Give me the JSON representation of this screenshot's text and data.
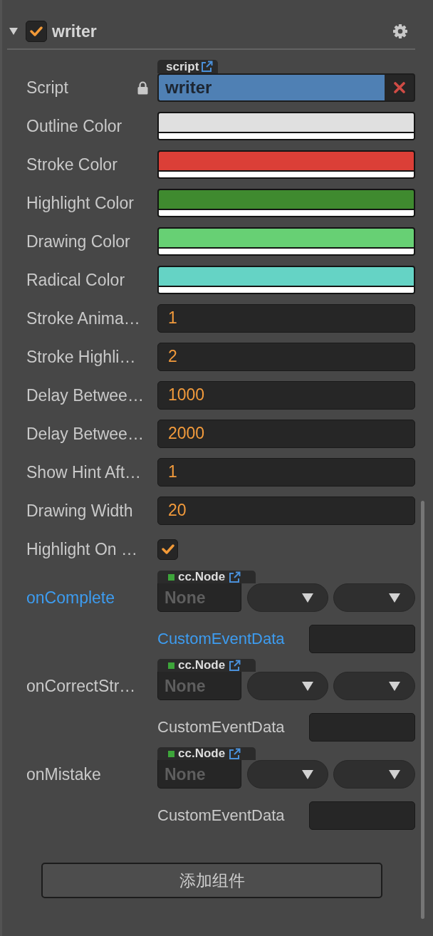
{
  "component": {
    "title": "writer",
    "expanded": true,
    "enabled": true
  },
  "properties": [
    {
      "kind": "script",
      "label": "Script",
      "locked": true,
      "tag": "script",
      "value": "writer"
    },
    {
      "kind": "color",
      "label": "Outline Color",
      "color": "#e0e0e0"
    },
    {
      "kind": "color",
      "label": "Stroke Color",
      "color": "#db3f37"
    },
    {
      "kind": "color",
      "label": "Highlight Color",
      "color": "#3f8a2f"
    },
    {
      "kind": "color",
      "label": "Drawing Color",
      "color": "#67d074"
    },
    {
      "kind": "color",
      "label": "Radical Color",
      "color": "#65d3c5"
    },
    {
      "kind": "number",
      "label": "Stroke Anima…",
      "value": "1"
    },
    {
      "kind": "number",
      "label": "Stroke Highli…",
      "value": "2"
    },
    {
      "kind": "number",
      "label": "Delay Betwee…",
      "value": "1000"
    },
    {
      "kind": "number",
      "label": "Delay Betwee…",
      "value": "2000"
    },
    {
      "kind": "number",
      "label": "Show Hint Aft…",
      "value": "1"
    },
    {
      "kind": "number",
      "label": "Drawing Width",
      "value": "20"
    },
    {
      "kind": "checkbox",
      "label": "Highlight On …",
      "checked": true
    }
  ],
  "events": [
    {
      "label": "onComplete",
      "highlighted": true,
      "tag": "cc.Node",
      "target": "None",
      "data_label": "CustomEventData"
    },
    {
      "label": "onCorrectStr…",
      "highlighted": false,
      "tag": "cc.Node",
      "target": "None",
      "data_label": "CustomEventData"
    },
    {
      "label": "onMistake",
      "highlighted": false,
      "tag": "cc.Node",
      "target": "None",
      "data_label": "CustomEventData"
    }
  ],
  "add_button": "添加组件"
}
